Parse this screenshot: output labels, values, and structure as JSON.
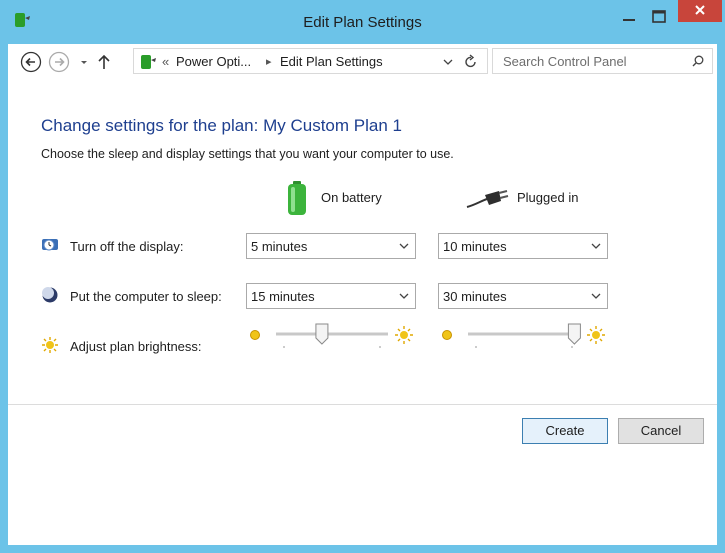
{
  "window": {
    "title": "Edit Plan Settings"
  },
  "toolbar": {
    "breadcrumb_sep": "«",
    "crumb1": "Power Opti...",
    "crumb_arrow": "▸",
    "crumb2": "Edit Plan Settings",
    "search_placeholder": "Search Control Panel"
  },
  "main": {
    "heading": "Change settings for the plan: My Custom Plan 1",
    "subtext": "Choose the sleep and display settings that you want your computer to use.",
    "col_battery": "On battery",
    "col_plugged": "Plugged in",
    "rows": [
      {
        "label": "Turn off the display:",
        "battery": "5 minutes",
        "plugged": "10 minutes"
      },
      {
        "label": "Put the computer to sleep:",
        "battery": "15 minutes",
        "plugged": "30 minutes"
      },
      {
        "label": "Adjust plan brightness:"
      }
    ],
    "brightness": {
      "battery_fraction": 0.41,
      "plugged_fraction": 0.95
    }
  },
  "footer": {
    "create_label": "Create",
    "cancel_label": "Cancel"
  },
  "colors": {
    "accent": "#1e3f8f",
    "frame": "#6cc3e8",
    "close": "#c8453b"
  }
}
